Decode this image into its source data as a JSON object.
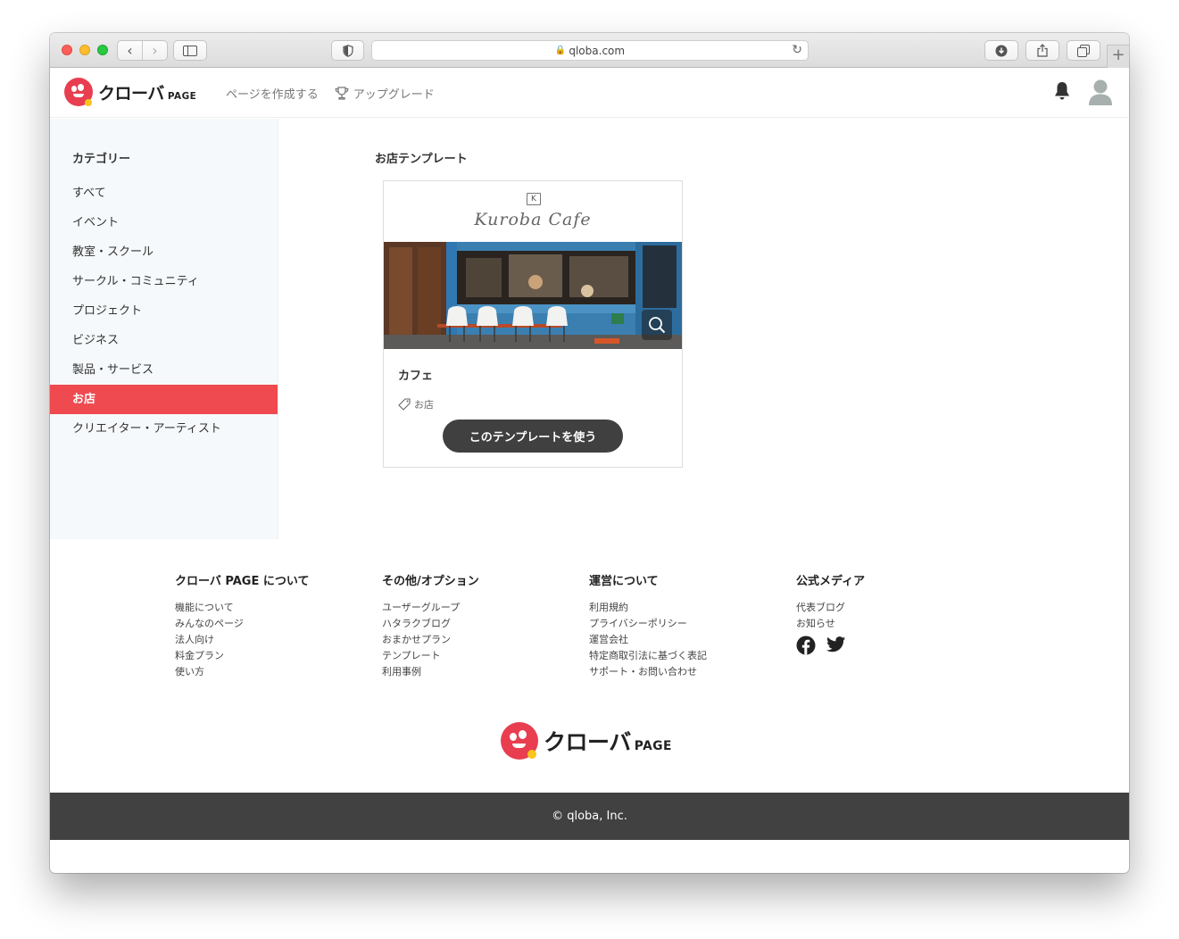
{
  "browser": {
    "url": "qloba.com"
  },
  "brand": {
    "name": "クローバ",
    "suffix": "PAGE",
    "accent": "#e83e50",
    "accent_dot": "#f7c51b"
  },
  "header": {
    "create_page": "ページを作成する",
    "upgrade": "アップグレード"
  },
  "sidebar": {
    "title": "カテゴリー",
    "items": [
      {
        "label": "すべて",
        "active": false
      },
      {
        "label": "イベント",
        "active": false
      },
      {
        "label": "教室・スクール",
        "active": false
      },
      {
        "label": "サークル・コミュニティ",
        "active": false
      },
      {
        "label": "プロジェクト",
        "active": false
      },
      {
        "label": "ビジネス",
        "active": false
      },
      {
        "label": "製品・サービス",
        "active": false
      },
      {
        "label": "お店",
        "active": true
      },
      {
        "label": "クリエイター・アーティスト",
        "active": false
      }
    ],
    "active_color": "#ef4a50"
  },
  "main": {
    "section_title": "お店テンプレート",
    "card": {
      "brand_text": "Kuroba Cafe",
      "title": "カフェ",
      "tag": "お店",
      "button": "このテンプレートを使う"
    }
  },
  "footer": {
    "columns": [
      {
        "heading": "クローバ PAGE について",
        "links": [
          "機能について",
          "みんなのページ",
          "法人向け",
          "料金プラン",
          "使い方"
        ]
      },
      {
        "heading": "その他/オプション",
        "links": [
          "ユーザーグループ",
          "ハタラクブログ",
          "おまかせプラン",
          "テンプレート",
          "利用事例"
        ]
      },
      {
        "heading": "運営について",
        "links": [
          "利用規約",
          "プライバシーポリシー",
          "運営会社",
          "特定商取引法に基づく表記",
          "サポート・お問い合わせ"
        ]
      },
      {
        "heading": "公式メディア",
        "links": [
          "代表ブログ",
          "お知らせ"
        ]
      }
    ],
    "social": [
      "facebook-icon",
      "twitter-icon"
    ],
    "copyright": "© qloba, Inc."
  }
}
